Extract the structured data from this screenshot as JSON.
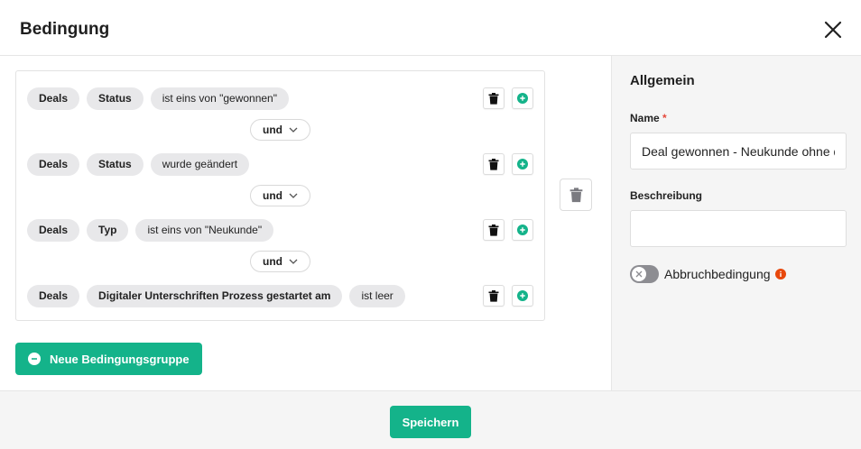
{
  "dialog": {
    "title": "Bedingung"
  },
  "conditions": [
    {
      "entity": "Deals",
      "field": "Status",
      "operator": "ist eins von \"gewonnen\""
    },
    {
      "entity": "Deals",
      "field": "Status",
      "operator": "wurde geändert"
    },
    {
      "entity": "Deals",
      "field": "Typ",
      "operator": "ist eins von \"Neukunde\""
    },
    {
      "entity": "Deals",
      "field": "Digitaler Unterschriften Prozess gestartet am",
      "operator": "ist leer"
    }
  ],
  "joins": [
    "und",
    "und",
    "und"
  ],
  "new_group_label": "Neue Bedingungsgruppe",
  "panel": {
    "title": "Allgemein",
    "name_label": "Name",
    "name_required": "*",
    "name_value": "Deal gewonnen - Neukunde ohne d",
    "description_label": "Beschreibung",
    "description_value": "",
    "abort_label": "Abbruchbedingung",
    "abort_enabled": false
  },
  "save_label": "Speichern",
  "colors": {
    "accent": "#14b38a",
    "info": "#e8480c",
    "required": "#e5483b"
  }
}
